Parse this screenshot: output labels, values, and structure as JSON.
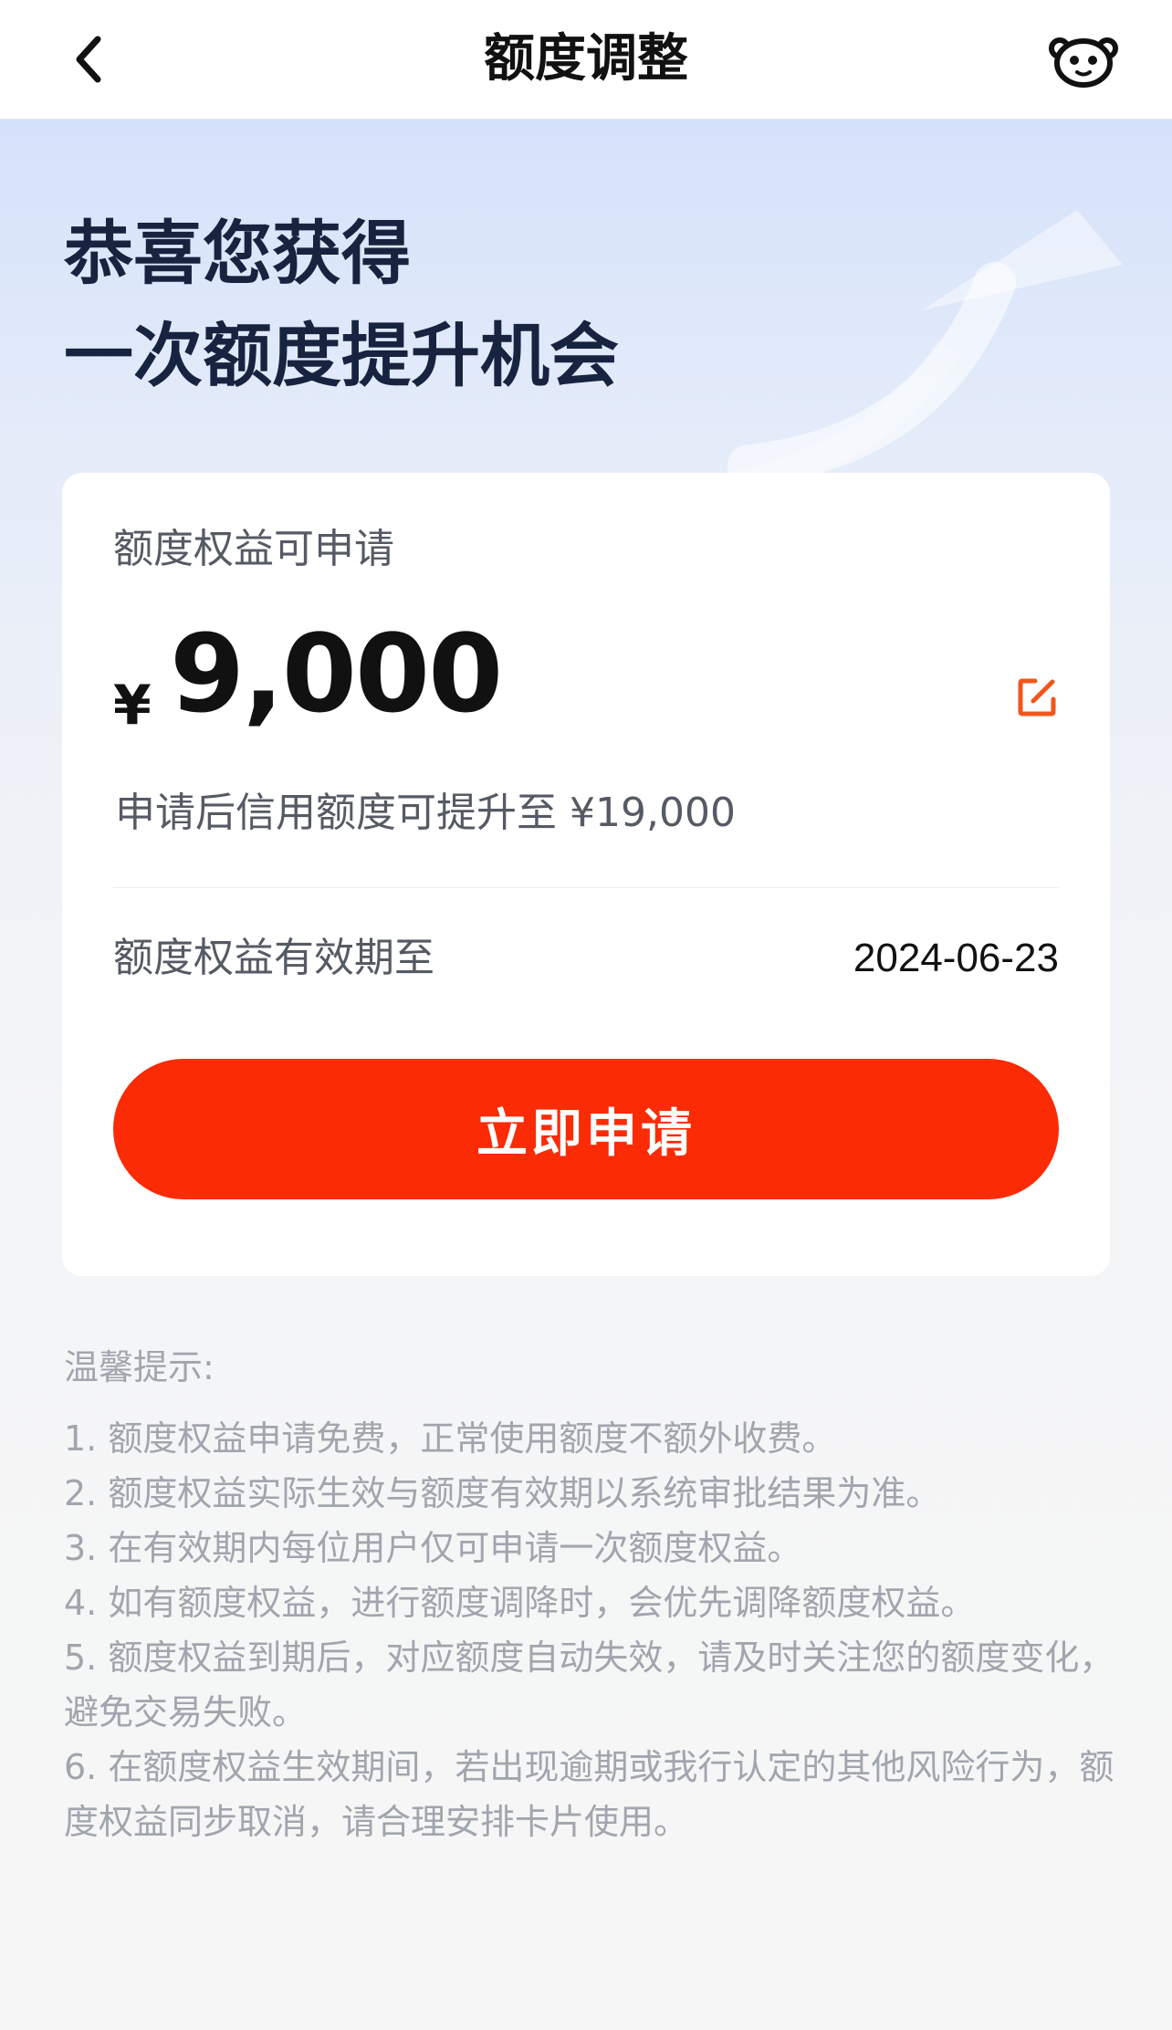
{
  "nav": {
    "title": "额度调整",
    "back_icon": "chevron-left-icon",
    "service_icon": "robot-service-icon"
  },
  "hero": {
    "line1": "恭喜您获得",
    "line2": "一次额度提升机会"
  },
  "card": {
    "label": "额度权益可申请",
    "currency": "¥",
    "amount": "9,000",
    "edit_icon": "edit-icon",
    "increase_note": "申请后信用额度可提升至 ¥19,000",
    "validity_label": "额度权益有效期至",
    "validity_date": "2024-06-23",
    "apply_label": "立即申请"
  },
  "tips": {
    "title": "温馨提示:",
    "items": [
      "1. 额度权益申请免费，正常使用额度不额外收费。",
      "2. 额度权益实际生效与额度有效期以系统审批结果为准。",
      "3. 在有效期内每位用户仅可申请一次额度权益。",
      "4. 如有额度权益，进行额度调降时，会优先调降额度权益。",
      "5. 额度权益到期后，对应额度自动失效，请及时关注您的额度变化，避免交易失败。",
      "6. 在额度权益生效期间，若出现逾期或我行认定的其他风险行为，额度权益同步取消，请合理安排卡片使用。"
    ]
  },
  "colors": {
    "accent": "#fb2b06",
    "edit_icon": "#f0561c",
    "headline": "#17233f"
  }
}
